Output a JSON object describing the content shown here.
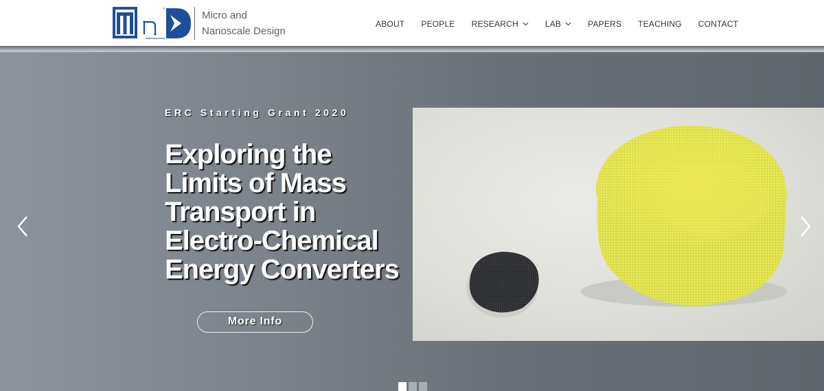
{
  "brand": {
    "line1": "Micro and",
    "line2": "Nanoscale Design",
    "logo_icon": "mnd-logo-icon",
    "accent_color": "#1f4e9c"
  },
  "nav": {
    "items": [
      {
        "label": "ABOUT",
        "dropdown": false
      },
      {
        "label": "PEOPLE",
        "dropdown": false
      },
      {
        "label": "RESEARCH",
        "dropdown": true,
        "icon": "chevron-down-icon"
      },
      {
        "label": "LAB",
        "dropdown": true,
        "icon": "chevron-down-icon"
      },
      {
        "label": "PAPERS",
        "dropdown": false
      },
      {
        "label": "TEACHING",
        "dropdown": false
      },
      {
        "label": "CONTACT",
        "dropdown": false
      }
    ]
  },
  "hero": {
    "kicker": "ERC Starting Grant 2020",
    "headline_lines": [
      "Exploring the",
      "Limits of Mass",
      "Transport in",
      "Electro-Chemical",
      "Energy Converters"
    ],
    "button_label": "More Info",
    "prev_icon": "chevron-left-icon",
    "next_icon": "chevron-right-icon",
    "slide_count": 3,
    "active_slide": 1
  }
}
